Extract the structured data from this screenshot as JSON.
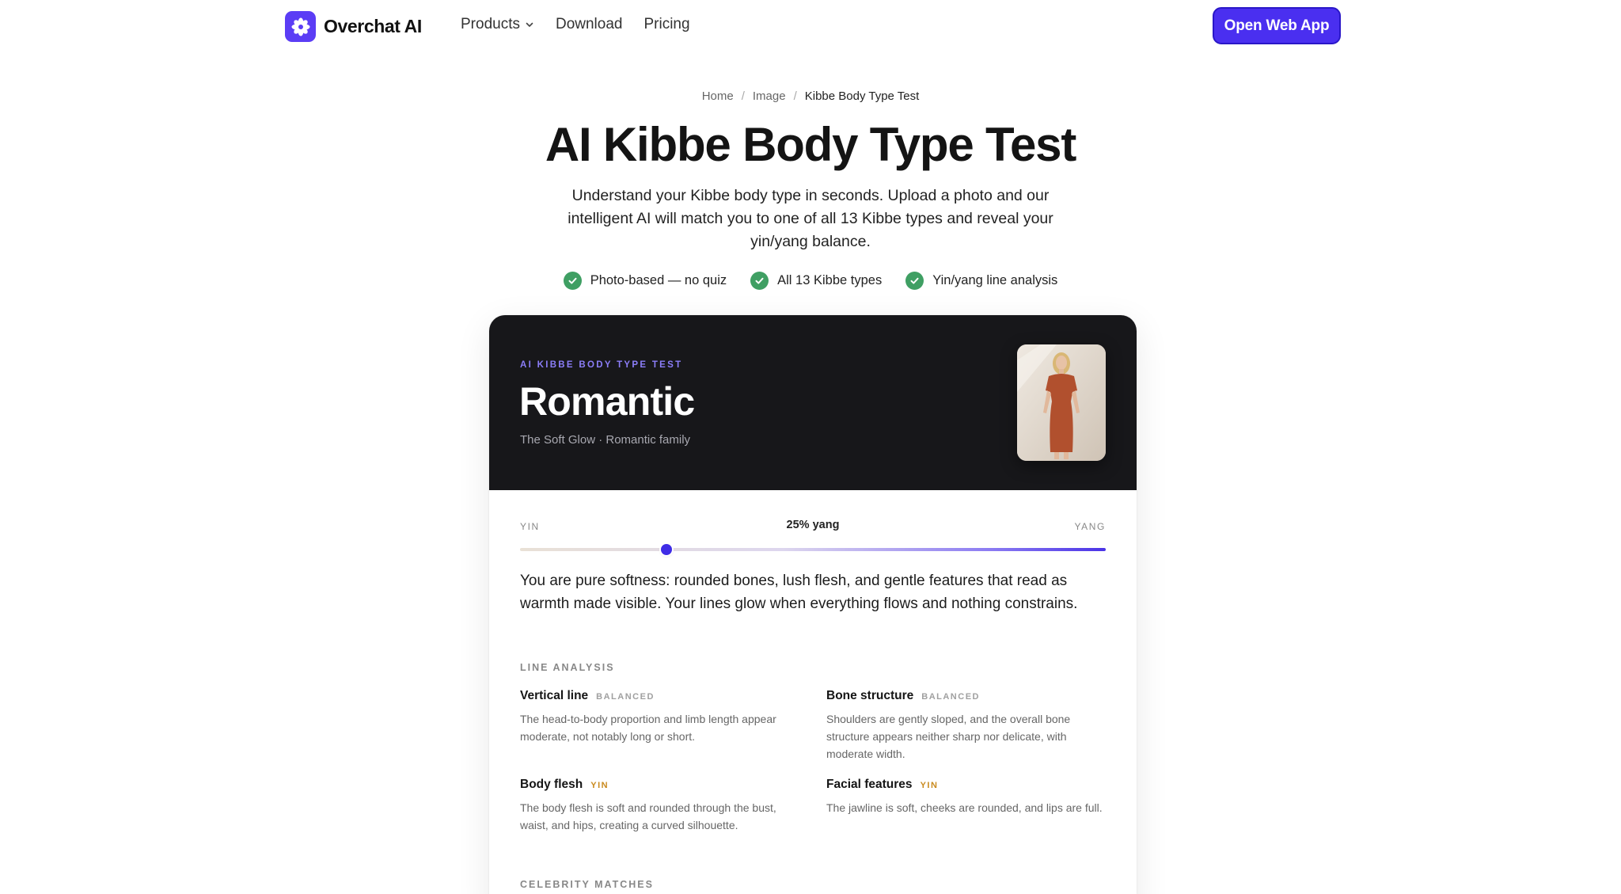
{
  "nav": {
    "brand": "Overchat AI",
    "logo_icon": "asterisk-flower-icon",
    "links": [
      "Products",
      "Download",
      "Pricing"
    ],
    "cta": "Open Web App",
    "brand_color": "#5b3df5"
  },
  "breadcrumb": {
    "home": "Home",
    "sep1": "/",
    "category": "Image",
    "sep2": "/",
    "current": "Kibbe Body Type Test"
  },
  "hero": {
    "title": "AI Kibbe Body Type Test",
    "subtitle": "Understand your Kibbe body type in seconds. Upload a photo and our intelligent AI will match you to one of all 13 Kibbe types and reveal your yin/yang balance.",
    "features": [
      "Photo-based — no quiz",
      "All 13 Kibbe types",
      "Yin/yang line analysis"
    ]
  },
  "result": {
    "eyebrow": "AI KIBBE BODY TYPE TEST",
    "type": "Romantic",
    "subtitle": "The Soft Glow · Romantic family",
    "scale_left": "YIN",
    "scale_right": "YANG",
    "scale_value": "25% yang",
    "yang_fraction": 0.25,
    "description": "You are pure softness: rounded bones, lush flesh, and gentle features that read as warmth made visible. Your lines glow when everything flows and nothing constrains."
  },
  "line_analysis": {
    "label": "LINE ANALYSIS",
    "traits": [
      {
        "name": "Vertical line",
        "tag": "BALANCED",
        "text": "The head-to-body proportion and limb length appear moderate, not notably long or short."
      },
      {
        "name": "Bone structure",
        "tag": "BALANCED",
        "text": "Shoulders are gently sloped, and the overall bone structure appears neither sharp nor delicate, with moderate width."
      },
      {
        "name": "Body flesh",
        "tag": "YIN",
        "text": "The body flesh is soft and rounded through the bust, waist, and hips, creating a curved silhouette."
      },
      {
        "name": "Facial features",
        "tag": "YIN",
        "text": "The jawline is soft, cheeks are rounded, and lips are full."
      }
    ]
  },
  "celebrity": {
    "label": "CELEBRITY MATCHES"
  }
}
